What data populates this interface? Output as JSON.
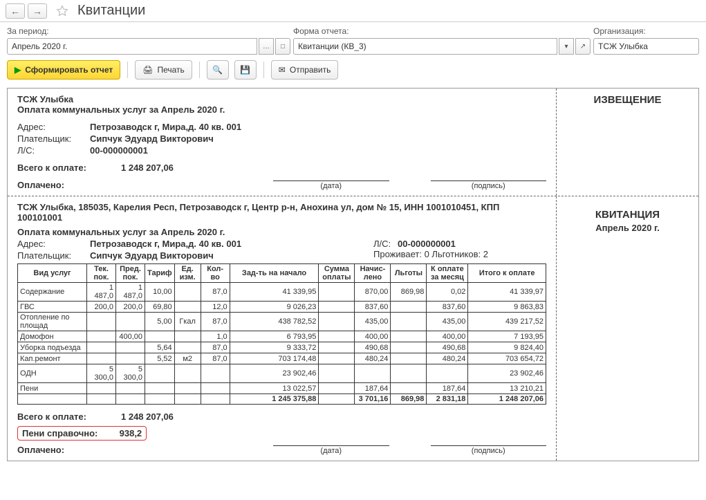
{
  "title": "Квитанции",
  "filters": {
    "period_label": "За период:",
    "period_value": "Апрель 2020 г.",
    "form_label": "Форма отчета:",
    "form_value": "Квитанции (КВ_3)",
    "org_label": "Организация:",
    "org_value": "ТСЖ Улыбка"
  },
  "toolbar": {
    "generate": "Сформировать отчет",
    "print": "Печать",
    "send": "Отправить"
  },
  "notice": {
    "org": "ТСЖ Улыбка",
    "title": "Оплата коммунальных услуг за Апрель 2020 г.",
    "addr_label": "Адрес:",
    "addr": "Петрозаводск г, Мира,д. 40 кв. 001",
    "payer_label": "Плательщик:",
    "payer": "Сипчук Эдуард Викторович",
    "acc_label": "Л/С:",
    "acc": "00-000000001",
    "total_label": "Всего к оплате:",
    "total": "1 248 207,06",
    "paid_label": "Оплачено:",
    "sig_date": "(дата)",
    "sig_sign": "(подпись)",
    "badge": "ИЗВЕЩЕНИЕ"
  },
  "receipt": {
    "header": "ТСЖ Улыбка, 185035, Карелия Респ, Петрозаводск г, Центр р-н, Анохина ул, дом № 15, ИНН 1001010451, КПП 100101001",
    "title": "Оплата коммунальных услуг за Апрель 2020 г.",
    "addr_label": "Адрес:",
    "addr": "Петрозаводск г, Мира,д. 40 кв. 001",
    "payer_label": "Плательщик:",
    "payer": "Сипчук Эдуард Викторович",
    "acc_label": "Л/С:",
    "acc": "00-000000001",
    "residents": "Проживает: 0 Льготников: 2",
    "badge": "КВИТАНЦИЯ",
    "badge_sub": "Апрель 2020 г.",
    "total_label": "Всего к оплате:",
    "total": "1 248 207,06",
    "peni_label": "Пени справочно:",
    "peni": "938,2",
    "paid_label": "Оплачено:",
    "sig_date": "(дата)",
    "sig_sign": "(подпись)"
  },
  "table": {
    "h_service": "Вид услуг",
    "h_cur": "Тек. пок.",
    "h_prev": "Пред. пок.",
    "h_tariff": "Тариф",
    "h_unit": "Ед. изм.",
    "h_qty": "Кол-во",
    "h_debt": "Зад-ть на начало",
    "h_paid": "Сумма оплаты",
    "h_charged": "Начис- лено",
    "h_disc": "Льготы",
    "h_monthly": "К оплате за месяц",
    "h_total": "Итого к оплате",
    "rows": [
      {
        "name": "Содержание",
        "cur": "1 487,0",
        "prev": "1 487,0",
        "tariff": "10,00",
        "unit": "",
        "qty": "87,0",
        "debt": "41 339,95",
        "paid": "",
        "charged": "870,00",
        "disc": "869,98",
        "monthly": "0,02",
        "total": "41 339,97"
      },
      {
        "name": "ГВС",
        "cur": "200,0",
        "prev": "200,0",
        "tariff": "69,80",
        "unit": "",
        "qty": "12,0",
        "debt": "9 026,23",
        "paid": "",
        "charged": "837,60",
        "disc": "",
        "monthly": "837,60",
        "total": "9 863,83"
      },
      {
        "name": "Отопление по площад",
        "cur": "",
        "prev": "",
        "tariff": "5,00",
        "unit": "Гкал",
        "qty": "87,0",
        "debt": "438 782,52",
        "paid": "",
        "charged": "435,00",
        "disc": "",
        "monthly": "435,00",
        "total": "439 217,52"
      },
      {
        "name": "Домофон",
        "cur": "",
        "prev": "400,00",
        "tariff": "",
        "unit": "",
        "qty": "1,0",
        "debt": "6 793,95",
        "paid": "",
        "charged": "400,00",
        "disc": "",
        "monthly": "400,00",
        "total": "7 193,95"
      },
      {
        "name": "Уборка подъезда",
        "cur": "",
        "prev": "",
        "tariff": "5,64",
        "unit": "",
        "qty": "87,0",
        "debt": "9 333,72",
        "paid": "",
        "charged": "490,68",
        "disc": "",
        "monthly": "490,68",
        "total": "9 824,40"
      },
      {
        "name": "Кап.ремонт",
        "cur": "",
        "prev": "",
        "tariff": "5,52",
        "unit": "м2",
        "qty": "87,0",
        "debt": "703 174,48",
        "paid": "",
        "charged": "480,24",
        "disc": "",
        "monthly": "480,24",
        "total": "703 654,72"
      },
      {
        "name": "ОДН",
        "cur": "5 300,0",
        "prev": "5 300,0",
        "tariff": "",
        "unit": "",
        "qty": "",
        "debt": "23 902,46",
        "paid": "",
        "charged": "",
        "disc": "",
        "monthly": "",
        "total": "23 902,46"
      },
      {
        "name": "Пени",
        "cur": "",
        "prev": "",
        "tariff": "",
        "unit": "",
        "qty": "",
        "debt": "13 022,57",
        "paid": "",
        "charged": "187,64",
        "disc": "",
        "monthly": "187,64",
        "total": "13 210,21"
      }
    ],
    "totals": {
      "debt": "1 245 375,88",
      "paid": "",
      "charged": "3 701,16",
      "disc": "869,98",
      "monthly": "2 831,18",
      "total": "1 248 207,06"
    }
  }
}
